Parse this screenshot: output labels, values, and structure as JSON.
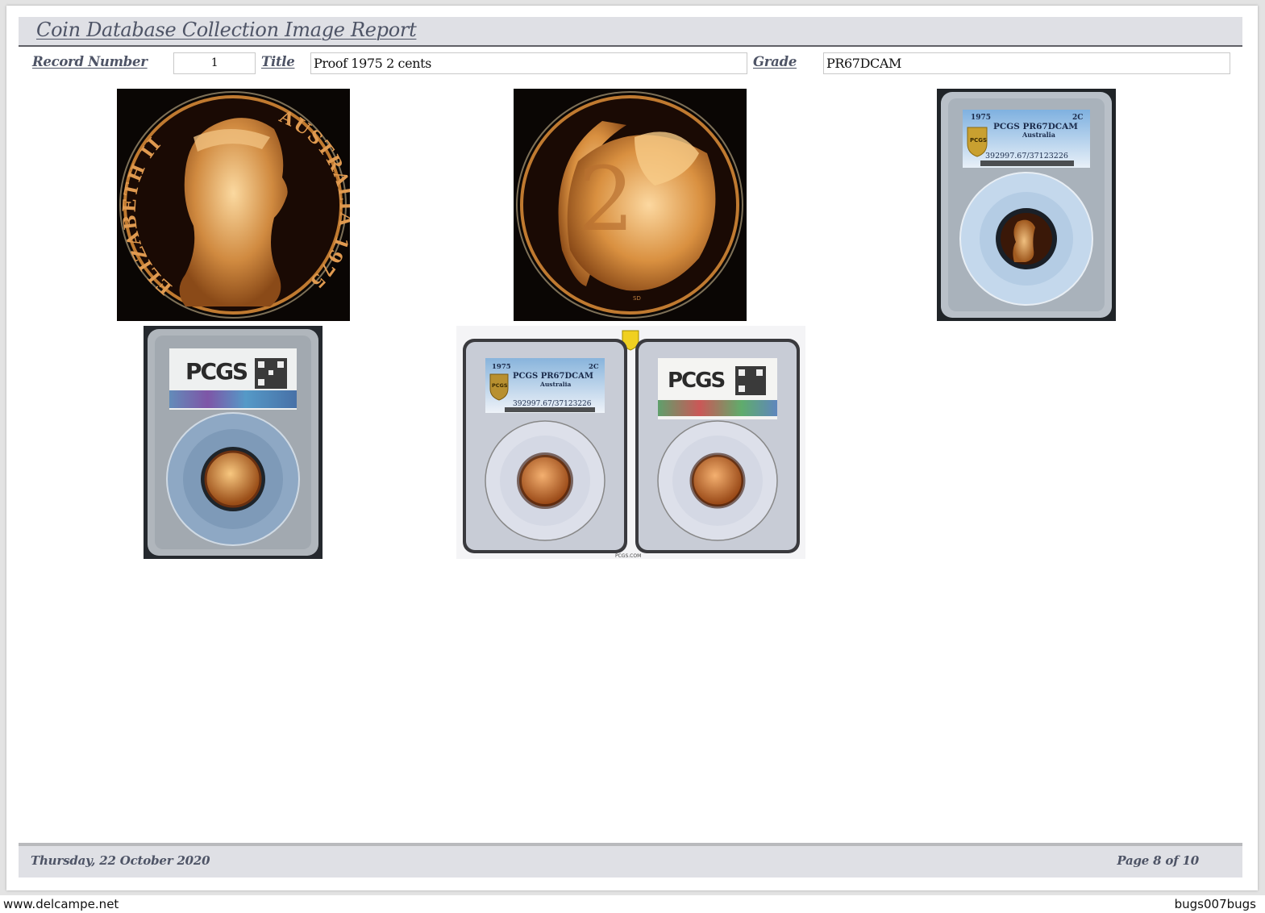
{
  "report": {
    "title": "Coin Database Collection Image Report"
  },
  "fields": {
    "record_number_label": "Record Number",
    "record_number_value": "1",
    "title_label": "Title",
    "title_value": "Proof 1975 2 cents",
    "grade_label": "Grade",
    "grade_value": "PR67DCAM"
  },
  "images": [
    {
      "name": "coin-obverse-photo",
      "type": "coin-closeup",
      "legend_left": "ELIZABETH II",
      "legend_right": "AUSTRALIA 1975"
    },
    {
      "name": "coin-reverse-photo",
      "type": "coin-closeup",
      "design_numeral": "2",
      "initials": "SD"
    },
    {
      "name": "slab-front-photo",
      "type": "slab-front",
      "label": {
        "year": "1975",
        "denomination": "2C",
        "grade_line": "PCGS PR67DCAM",
        "country": "Australia",
        "cert": "392997.67/37123226",
        "shield": "PCGS"
      }
    },
    {
      "name": "slab-back-photo",
      "type": "slab-back",
      "label": {
        "logo": "PCGS"
      }
    },
    {
      "name": "slab-front-back-photo",
      "type": "slab-pair",
      "label": {
        "year": "1975",
        "denomination": "2C",
        "grade_line": "PCGS PR67DCAM",
        "country": "Australia",
        "cert": "392997.67/37123226",
        "shield": "PCGS",
        "back_logo": "PCGS",
        "site": "PCGS.COM"
      }
    }
  ],
  "footer": {
    "date": "Thursday, 22 October 2020",
    "page": "Page 8 of 10"
  },
  "watermarks": {
    "left": "www.delcampe.net",
    "right": "bugs007bugs"
  },
  "colors": {
    "header_bg": "#dfe0e5",
    "label_text": "#4e5466",
    "coin_gold": "#e0a050"
  }
}
